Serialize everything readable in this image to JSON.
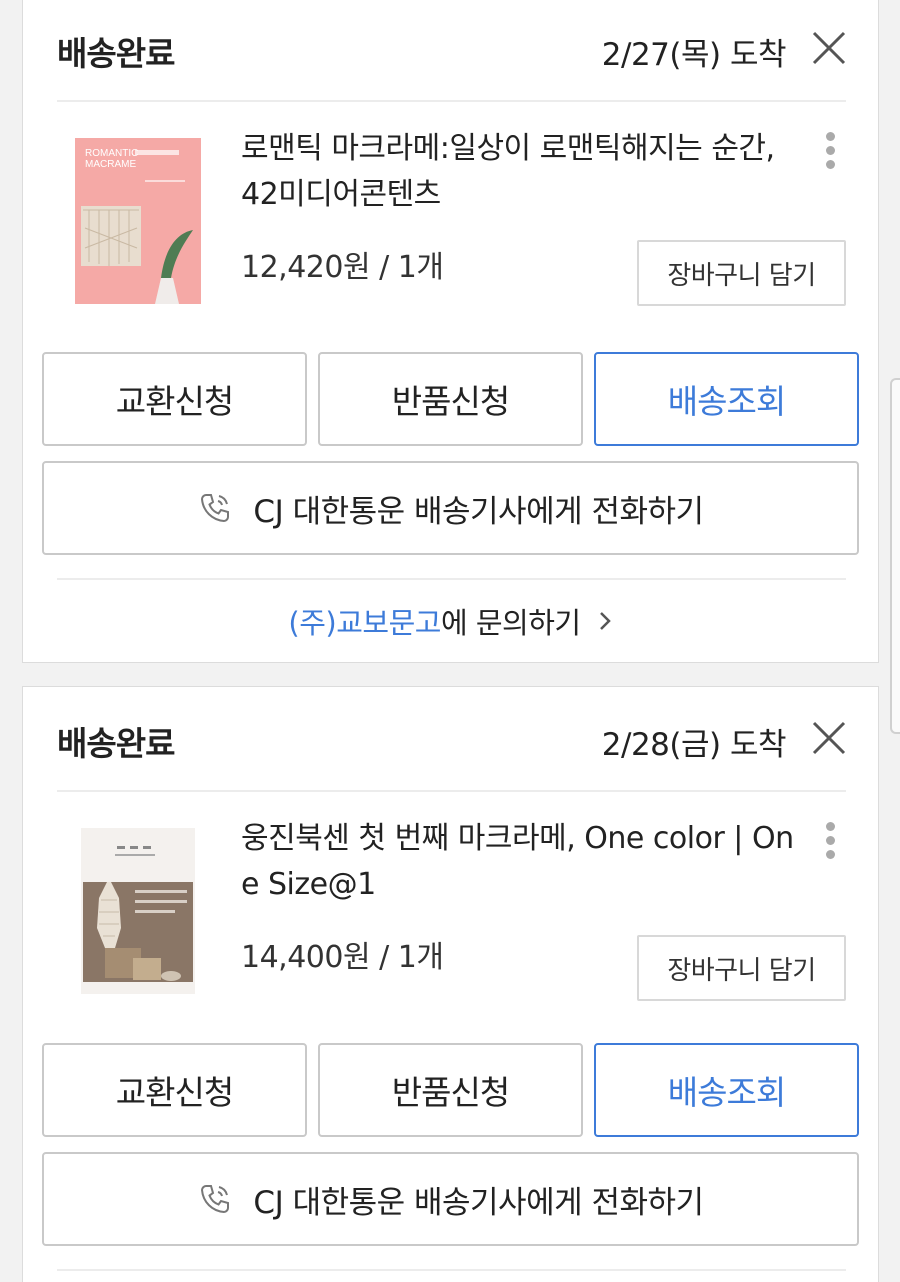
{
  "orders": [
    {
      "status": "배송완료",
      "arrival": "2/27(목) 도착",
      "product_title": "로맨틱 마크라메:일상이 로맨틱해지는 순간, 42미디어콘텐츠",
      "cover_title_line1": "ROMANTIC",
      "cover_title_line2": "MACRAME",
      "price": "12,420원 / 1개",
      "cart_label": "장바구니 담기",
      "exchange_label": "교환신청",
      "return_label": "반품신청",
      "track_label": "배송조회",
      "call_label": "CJ 대한통운 배송기사에게 전화하기",
      "seller": "(주)교보문고",
      "inquiry_suffix": "에 문의하기"
    },
    {
      "status": "배송완료",
      "arrival": "2/28(금) 도착",
      "product_title": "웅진북센 첫 번째 마크라메, One color | One Size@1",
      "price": "14,400원 / 1개",
      "cart_label": "장바구니 담기",
      "exchange_label": "교환신청",
      "return_label": "반품신청",
      "track_label": "배송조회",
      "call_label": "CJ 대한통운 배송기사에게 전화하기"
    }
  ],
  "colors": {
    "accent": "#3d7bd9",
    "border": "#c9c9c9",
    "background": "#f2f2f2",
    "cover1": "#f5a9a6",
    "cover2": "#ece8e4"
  },
  "icons": {
    "close": "close-icon",
    "kebab": "more-vertical-icon",
    "phone": "phone-icon",
    "chevron": "chevron-right-icon"
  }
}
